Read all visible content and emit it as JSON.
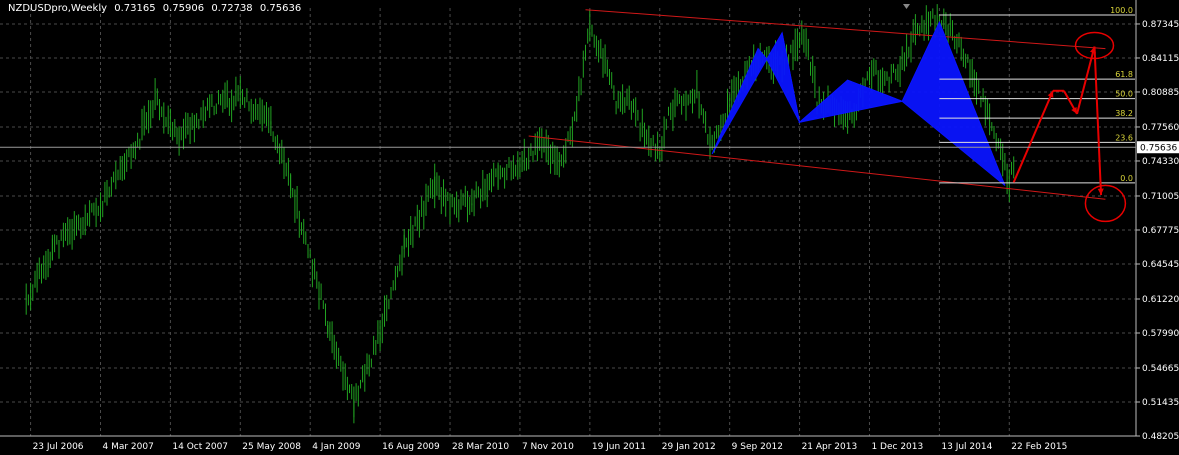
{
  "header": {
    "symbol_period": "NZDUSDpro,Weekly",
    "ohlc": [
      "0.73165",
      "0.75906",
      "0.72738",
      "0.75636"
    ]
  },
  "colors": {
    "background": "#000000",
    "grid": "#4a4a4a",
    "bars": "#21a321",
    "trendline": "#d01818",
    "harmonic": "#0a14ff",
    "fib": "#d9d43a",
    "projection": "#e80000",
    "price_label_bg": "#ffffff"
  },
  "chart_data": {
    "type": "line",
    "title": "NZDUSDpro,Weekly",
    "ylim": [
      0.48205,
      0.88862
    ],
    "y_ticks": [
      "0.87345",
      "0.84115",
      "0.80885",
      "0.77560",
      "0.74330",
      "0.71005",
      "0.67775",
      "0.64545",
      "0.61220",
      "0.57990",
      "0.54665",
      "0.51435",
      "0.48205"
    ],
    "x_ticks": [
      "23 Jul 2006",
      "4 Mar 2007",
      "14 Oct 2007",
      "25 May 2008",
      "4 Jan 2009",
      "16 Aug 2009",
      "28 Mar 2010",
      "7 Nov 2010",
      "19 Jun 2011",
      "29 Jan 2012",
      "9 Sep 2012",
      "21 Apr 2013",
      "1 Dec 2013",
      "13 Jul 2014",
      "22 Feb 2015"
    ],
    "current_price": "0.75636",
    "price_series": {
      "name": "",
      "x": [
        "2006-07-09",
        "2006-10-01",
        "2007-03-04",
        "2007-07-01",
        "2007-08-26",
        "2007-11-04",
        "2008-02-24",
        "2008-05-25",
        "2008-08-31",
        "2008-11-02",
        "2009-03-01",
        "2009-05-24",
        "2009-08-16",
        "2009-11-01",
        "2010-02-07",
        "2010-03-28",
        "2010-06-06",
        "2010-08-29",
        "2010-11-07",
        "2011-01-16",
        "2011-03-13",
        "2011-05-01",
        "2011-06-19",
        "2011-07-31",
        "2011-09-11",
        "2011-10-23",
        "2011-12-25",
        "2012-01-29",
        "2012-02-26",
        "2012-05-27",
        "2012-07-15",
        "2012-09-09",
        "2012-11-04",
        "2013-01-06",
        "2013-02-24",
        "2013-04-21",
        "2013-05-12",
        "2013-06-16",
        "2013-08-25",
        "2013-10-13",
        "2013-12-01",
        "2014-02-02",
        "2014-03-16",
        "2014-05-04",
        "2014-07-13",
        "2014-08-31",
        "2014-10-19",
        "2014-12-14",
        "2015-01-25",
        "2015-02-22",
        "2015-03-15"
      ],
      "values": [
        0.61,
        0.66,
        0.7,
        0.76,
        0.805,
        0.765,
        0.795,
        0.805,
        0.78,
        0.72,
        0.59,
        0.512,
        0.58,
        0.66,
        0.72,
        0.7,
        0.705,
        0.73,
        0.74,
        0.76,
        0.74,
        0.78,
        0.87,
        0.84,
        0.8,
        0.8,
        0.76,
        0.75,
        0.79,
        0.81,
        0.755,
        0.8,
        0.83,
        0.84,
        0.835,
        0.86,
        0.86,
        0.8,
        0.79,
        0.785,
        0.83,
        0.82,
        0.835,
        0.87,
        0.88,
        0.86,
        0.83,
        0.79,
        0.755,
        0.72,
        0.75
      ]
    },
    "harmonic_pattern": {
      "pattern_1": {
        "x": [
          "2012-07-15",
          "2012-12-09",
          "2013-01-06",
          "2013-02-24",
          "2013-04-21",
          "2013-06-16"
        ],
        "values": [
          0.75,
          0.85,
          0.84,
          0.865,
          0.78,
          0.785
        ]
      },
      "pattern_2": {
        "x": [
          "2013-04-21",
          "2013-09-22",
          "2014-03-16",
          "2014-07-13",
          "2015-02-08"
        ],
        "values": [
          0.78,
          0.82,
          0.8,
          0.875,
          0.72
        ]
      }
    },
    "trendlines": [
      {
        "x": [
          "2011-06-05",
          "2015-12-27"
        ],
        "values": [
          0.887,
          0.85
        ]
      },
      {
        "x": [
          "2010-12-05",
          "2015-12-27"
        ],
        "values": [
          0.767,
          0.707
        ]
      }
    ],
    "fibonacci": {
      "levels": [
        {
          "label": "100.0",
          "value": 0.882
        },
        {
          "label": "61.8",
          "value": 0.821
        },
        {
          "label": "50.0",
          "value": 0.8025
        },
        {
          "label": "38.2",
          "value": 0.784
        },
        {
          "label": "23.6",
          "value": 0.761
        },
        {
          "label": "0.0",
          "value": 0.7225
        }
      ],
      "x_start": "2014-07-13"
    },
    "projection": {
      "x": [
        "2015-03-08",
        "2015-07-12",
        "2015-08-16",
        "2015-09-27",
        "2015-11-22",
        "2015-12-13"
      ],
      "values": [
        0.723,
        0.81,
        0.81,
        0.788,
        0.852,
        0.711
      ],
      "circles": [
        {
          "x": "2015-11-22",
          "value": 0.853
        },
        {
          "x": "2015-12-27",
          "value": 0.703
        }
      ]
    }
  }
}
